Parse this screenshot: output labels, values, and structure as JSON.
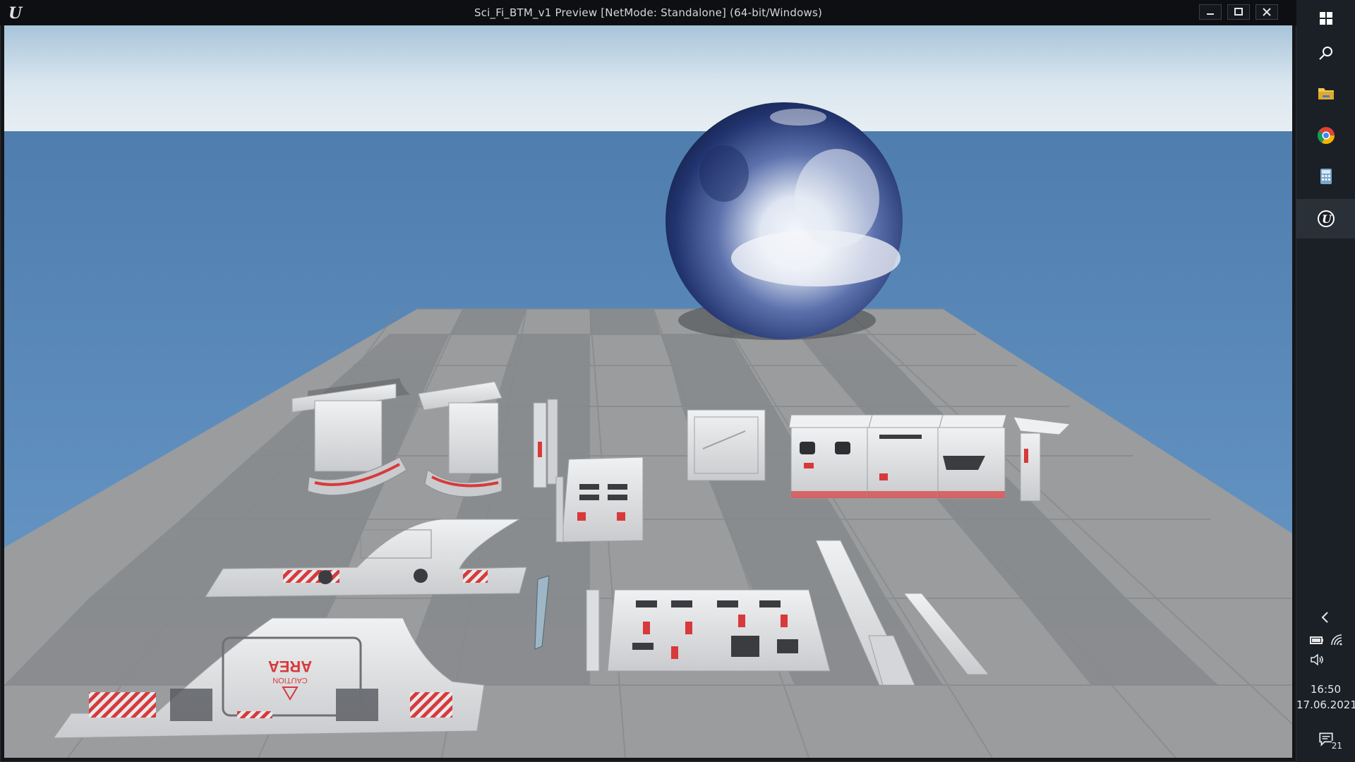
{
  "window": {
    "title": "Sci_Fi_BTM_v1 Preview [NetMode: Standalone]  (64-bit/Windows)",
    "app_icon": "unreal-engine-icon",
    "controls": [
      "minimize-icon",
      "maximize-icon",
      "close-icon"
    ]
  },
  "scene": {
    "caution_text_1": "AREA",
    "caution_text_2": "CAUTION"
  },
  "taskbar": {
    "apps": [
      {
        "name": "windows-start-icon"
      },
      {
        "name": "search-icon"
      },
      {
        "name": "file-explorer-icon"
      },
      {
        "name": "chrome-icon"
      },
      {
        "name": "calculator-icon"
      },
      {
        "name": "unreal-engine-icon",
        "active": true
      }
    ],
    "tray_icons": [
      "chevron-left-icon",
      "battery-icon",
      "wifi-icon",
      "volume-icon"
    ],
    "time": "16:50",
    "date": "17.06.2021",
    "notifications_count": "21"
  },
  "colors": {
    "sky_top": "#d9e6ef",
    "sea": "#5f8ebd",
    "floor_light": "#a9abad",
    "floor_dark": "#8d8f91",
    "accent_red": "#d8393b",
    "taskbar": "#1b2027"
  }
}
